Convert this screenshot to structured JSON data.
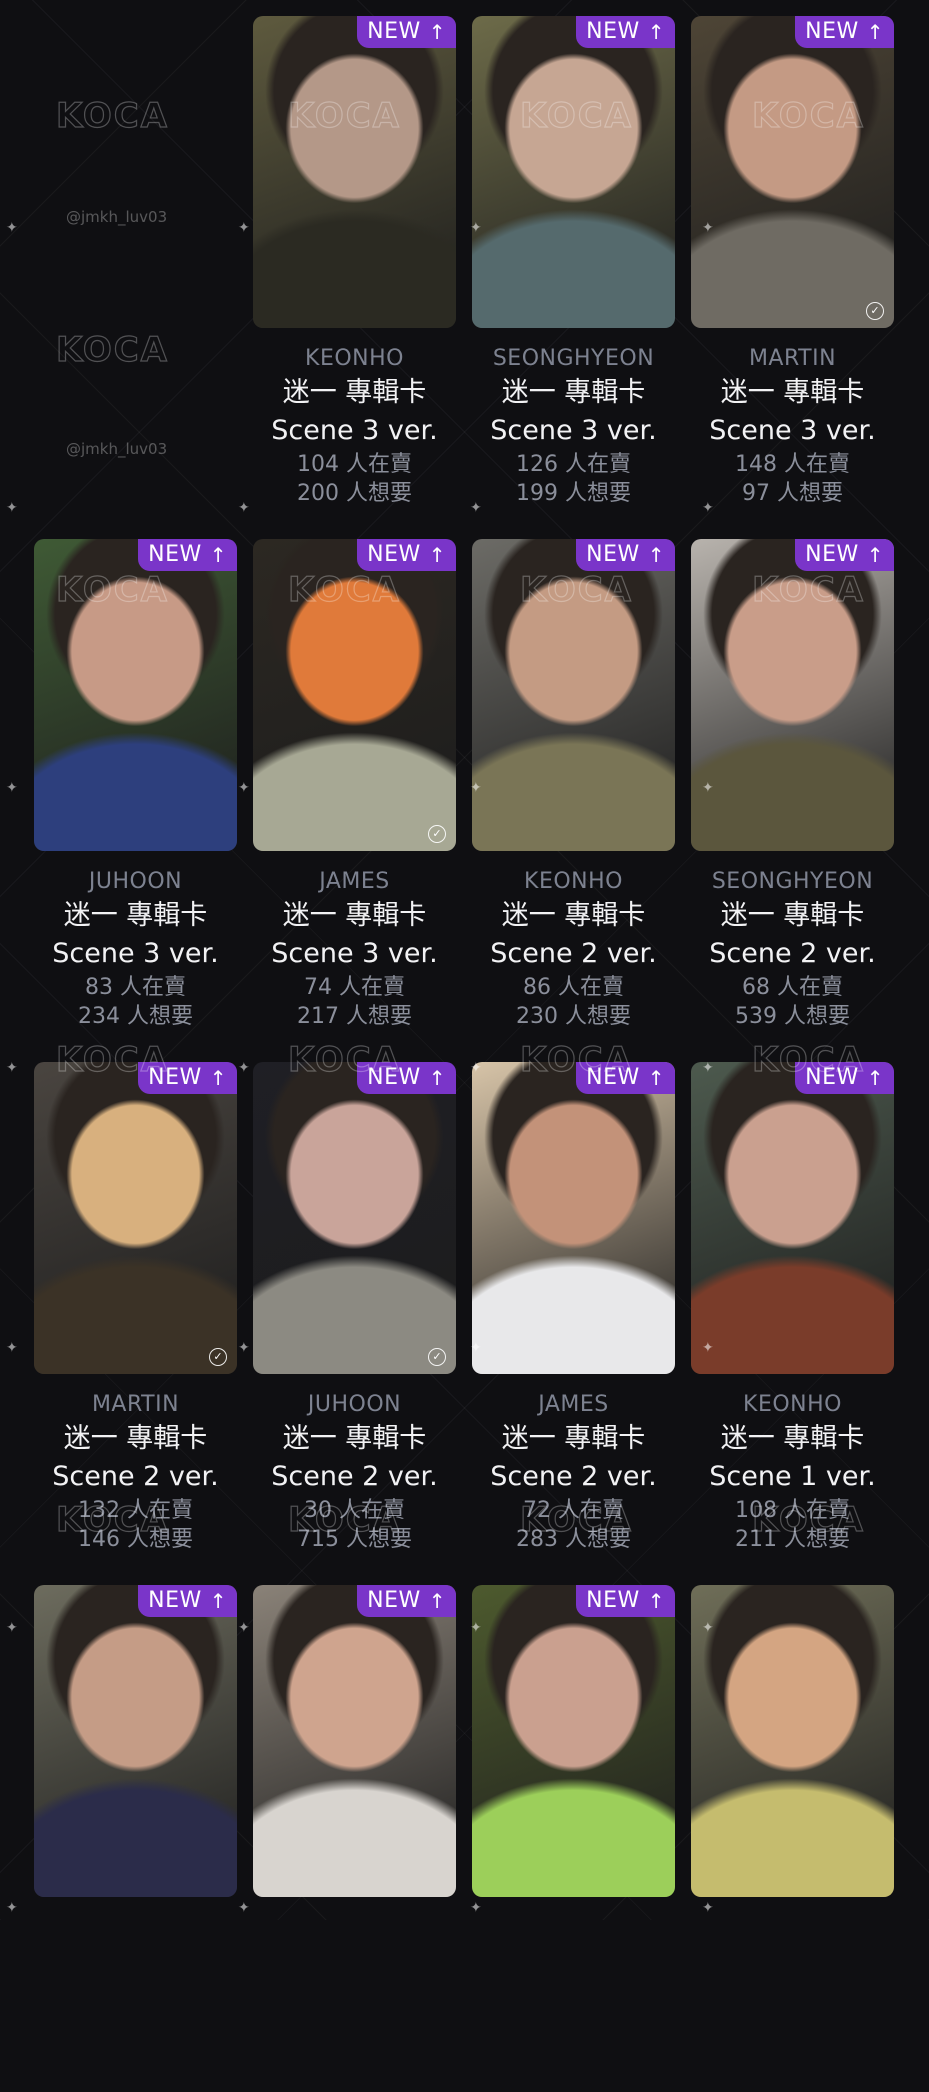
{
  "watermark": {
    "brand": "KOCA",
    "handle": "@jmkh_luv03"
  },
  "badge": {
    "label": "NEW",
    "arrow": "↑"
  },
  "cards": [
    {
      "member": "KEONHO",
      "title": "迷一 專輯卡",
      "version": "Scene 3 ver.",
      "selling": "104 人在賣",
      "wanting": "200 人想要",
      "owned": false,
      "colors": [
        "#5e5a3e",
        "#b49888",
        "#2b2a22"
      ]
    },
    {
      "member": "SEONGHYEON",
      "title": "迷一 專輯卡",
      "version": "Scene 3 ver.",
      "selling": "126 人在賣",
      "wanting": "199 人想要",
      "owned": false,
      "colors": [
        "#6d6b49",
        "#c6a693",
        "#556a6d"
      ]
    },
    {
      "member": "MARTIN",
      "title": "迷一 專輯卡",
      "version": "Scene 3 ver.",
      "selling": "148 人在賣",
      "wanting": "97 人想要",
      "owned": true,
      "colors": [
        "#4e4536",
        "#c49a84",
        "#6f6b63"
      ]
    },
    {
      "member": "JUHOON",
      "title": "迷一 專輯卡",
      "version": "Scene 3 ver.",
      "selling": "83 人在賣",
      "wanting": "234 人想要",
      "owned": false,
      "colors": [
        "#3f5a35",
        "#c79a86",
        "#2d3f7d"
      ]
    },
    {
      "member": "JAMES",
      "title": "迷一 專輯卡",
      "version": "Scene 3 ver.",
      "selling": "74 人在賣",
      "wanting": "217 人想要",
      "owned": true,
      "colors": [
        "#2c2822",
        "#e07a3a",
        "#a7a894"
      ]
    },
    {
      "member": "KEONHO",
      "title": "迷一 專輯卡",
      "version": "Scene 2 ver.",
      "selling": "86 人在賣",
      "wanting": "230 人想要",
      "owned": false,
      "colors": [
        "#6c6b66",
        "#c49b83",
        "#7a7556"
      ]
    },
    {
      "member": "SEONGHYEON",
      "title": "迷一 專輯卡",
      "version": "Scene 2 ver.",
      "selling": "68 人在賣",
      "wanting": "539 人想要",
      "owned": false,
      "colors": [
        "#b8b3ad",
        "#c99d89",
        "#5b563d"
      ]
    },
    {
      "member": "MARTIN",
      "title": "迷一 專輯卡",
      "version": "Scene 2 ver.",
      "selling": "132 人在賣",
      "wanting": "146 人想要",
      "owned": true,
      "colors": [
        "#4a4540",
        "#d8b07e",
        "#3b3226"
      ]
    },
    {
      "member": "JUHOON",
      "title": "迷一 專輯卡",
      "version": "Scene 2 ver.",
      "selling": "30 人在賣",
      "wanting": "715 人想要",
      "owned": true,
      "colors": [
        "#1f1f25",
        "#c9a49a",
        "#8c8a82"
      ]
    },
    {
      "member": "JAMES",
      "title": "迷一 專輯卡",
      "version": "Scene 2 ver.",
      "selling": "72 人在賣",
      "wanting": "283 人想要",
      "owned": false,
      "colors": [
        "#d7c4a8",
        "#c39279",
        "#e8e8ea"
      ]
    },
    {
      "member": "KEONHO",
      "title": "迷一 專輯卡",
      "version": "Scene 1 ver.",
      "selling": "108 人在賣",
      "wanting": "211 人想要",
      "owned": false,
      "colors": [
        "#4d5a4e",
        "#caa08f",
        "#7a3c2a"
      ]
    },
    {
      "member": "",
      "title": "",
      "version": "",
      "selling": "",
      "wanting": "",
      "owned": false,
      "badge": true,
      "colors": [
        "#6d6c5e",
        "#c59c86",
        "#2b2c4a"
      ]
    },
    {
      "member": "",
      "title": "",
      "version": "",
      "selling": "",
      "wanting": "",
      "owned": false,
      "badge": true,
      "colors": [
        "#8a8278",
        "#cfa48e",
        "#d8d4cf"
      ]
    },
    {
      "member": "",
      "title": "",
      "version": "",
      "selling": "",
      "wanting": "",
      "owned": false,
      "badge": true,
      "colors": [
        "#4d5a2e",
        "#caa08f",
        "#9ccf5a"
      ]
    },
    {
      "member": "",
      "title": "",
      "version": "",
      "selling": "",
      "wanting": "",
      "owned": false,
      "badge": false,
      "colors": [
        "#6f6e58",
        "#d4a582",
        "#c5bc6e"
      ]
    }
  ]
}
